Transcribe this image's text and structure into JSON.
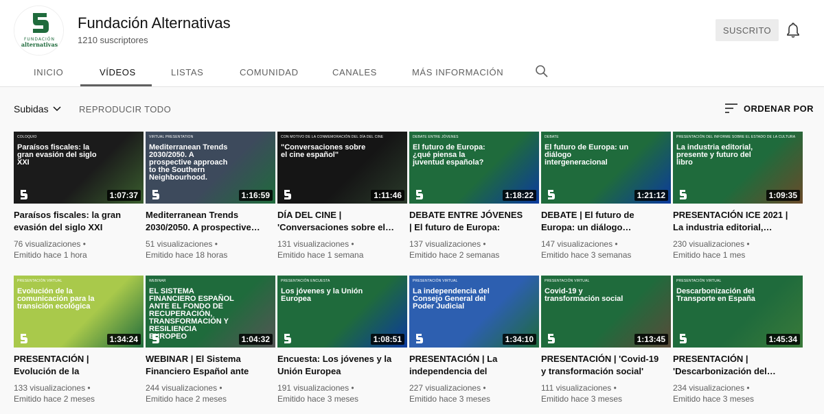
{
  "channel": {
    "name": "Fundación Alternativas",
    "subscribers": "1210 suscriptores",
    "avatar_text": "FUNDACIÓN alternativas",
    "subscribed_label": "SUSCRITO"
  },
  "tabs": [
    {
      "label": "INICIO"
    },
    {
      "label": "VÍDEOS"
    },
    {
      "label": "LISTAS"
    },
    {
      "label": "COMUNIDAD"
    },
    {
      "label": "CANALES"
    },
    {
      "label": "MÁS INFORMACIÓN"
    }
  ],
  "sort": {
    "filter_label": "Subidas",
    "play_all": "REPRODUCIR TODO",
    "order_by": "ORDENAR POR"
  },
  "colors": {
    "brand_green": "#1f6b3c"
  },
  "videos": [
    {
      "tag": "COLOQUIO",
      "thumb_title": "Paraísos fiscales: la gran evasión del siglo XXI",
      "duration": "1:07:37",
      "title": "Paraísos fiscales: la gran evasión del siglo XXI",
      "views": "76 visualizaciones •",
      "date": "Emitido hace 1 hora",
      "bg": "#1b1b1b",
      "accent": "#3a5e2e"
    },
    {
      "tag": "VIRTUAL PRESENTATION",
      "thumb_title": "Mediterranean Trends 2030/2050. A prospective approach to the Southern Neighbourhood.",
      "duration": "1:16:59",
      "title": "Mediterranean Trends 2030/2050. A prospective…",
      "views": "51 visualizaciones •",
      "date": "Emitido hace 18 horas",
      "bg": "#3d4a5c",
      "accent": "#1f6b3c"
    },
    {
      "tag": "CON MOTIVO DE LA CONMEMORACIÓN DEL DÍA DEL CINE",
      "thumb_title": "\"Conversaciones sobre el cine español\"",
      "duration": "1:11:46",
      "title": "DÍA DEL CINE | 'Conversaciones sobre el…",
      "views": "131 visualizaciones •",
      "date": "Emitido hace 1 semana",
      "bg": "#151515",
      "accent": "#2a3a2a"
    },
    {
      "tag": "DEBATE ENTRE JÓVENES",
      "thumb_title": "El futuro de Europa: ¿qué piensa la juventud española?",
      "duration": "1:18:22",
      "title": "DEBATE ENTRE JÓVENES | El futuro de Europa: ¿qué…",
      "views": "137 visualizaciones •",
      "date": "Emitido hace 2 semanas",
      "bg": "#1f6b3c",
      "accent": "#0c3a9e"
    },
    {
      "tag": "DEBATE",
      "thumb_title": "El futuro de Europa: un diálogo intergeneracional",
      "duration": "1:21:12",
      "title": "DEBATE | El futuro de Europa: un diálogo…",
      "views": "147 visualizaciones •",
      "date": "Emitido hace 3 semanas",
      "bg": "#1f6b3c",
      "accent": "#0c3a9e"
    },
    {
      "tag": "PRESENTACIÓN DEL INFORME SOBRE EL ESTADO DE LA CULTURA",
      "thumb_title": "La industria editorial, presente y futuro del libro",
      "duration": "1:09:35",
      "title": "PRESENTACIÓN ICE 2021 | La industria editorial,…",
      "views": "230 visualizaciones •",
      "date": "Emitido hace 1 mes",
      "bg": "#1f6b3c",
      "accent": "#6a4a2a"
    },
    {
      "tag": "PRESENTACIÓN VIRTUAL",
      "thumb_title": "Evolución de la comunicación para la transición ecológica",
      "duration": "1:34:24",
      "title": "PRESENTACIÓN | Evolución de la comunicación para la…",
      "views": "133 visualizaciones •",
      "date": "Emitido hace 2 meses",
      "bg": "#a9c94b",
      "accent": "#1f6b3c"
    },
    {
      "tag": "WEBINAR",
      "thumb_title": "EL SISTEMA FINANCIERO ESPAÑOL ANTE EL FONDO DE RECUPERACIÓN, TRANSFORMACIÓN Y RESILIENCIA EUROPEO",
      "duration": "1:04:32",
      "title": "WEBINAR | El Sistema Financiero Español ante el…",
      "views": "244 visualizaciones •",
      "date": "Emitido hace 2 meses",
      "bg": "#1f6b3c",
      "accent": "#555555"
    },
    {
      "tag": "PRESENTACIÓN ENCUESTA",
      "thumb_title": "Los jóvenes y la Unión Europea",
      "duration": "1:08:51",
      "title": "Encuesta: Los jóvenes y la Unión Europea",
      "views": "191 visualizaciones •",
      "date": "Emitido hace 3 meses",
      "bg": "#1f6b3c",
      "accent": "#0c3a9e"
    },
    {
      "tag": "PRESENTACIÓN VIRTUAL",
      "thumb_title": "La independencia del Consejo General del Poder Judicial",
      "duration": "1:34:10",
      "title": "PRESENTACIÓN | La independencia del Consejo…",
      "views": "227 visualizaciones •",
      "date": "Emitido hace 3 meses",
      "bg": "#2d5fb0",
      "accent": "#1f6b3c"
    },
    {
      "tag": "PRESENTACIÓN VIRTUAL",
      "thumb_title": "Covid-19 y transformación social",
      "duration": "1:13:45",
      "title": "PRESENTACIÓN | 'Covid-19 y transformación social'",
      "views": "111 visualizaciones •",
      "date": "Emitido hace 3 meses",
      "bg": "#1f6b3c",
      "accent": "#5a4a3a"
    },
    {
      "tag": "PRESENTACIÓN VIRTUAL",
      "thumb_title": "Descarbonización del Transporte en España",
      "duration": "1:45:34",
      "title": "PRESENTACIÓN | 'Descarbonización del…",
      "views": "234 visualizaciones •",
      "date": "Emitido hace 3 meses",
      "bg": "#1f6b3c",
      "accent": "#3a7a3a"
    }
  ]
}
